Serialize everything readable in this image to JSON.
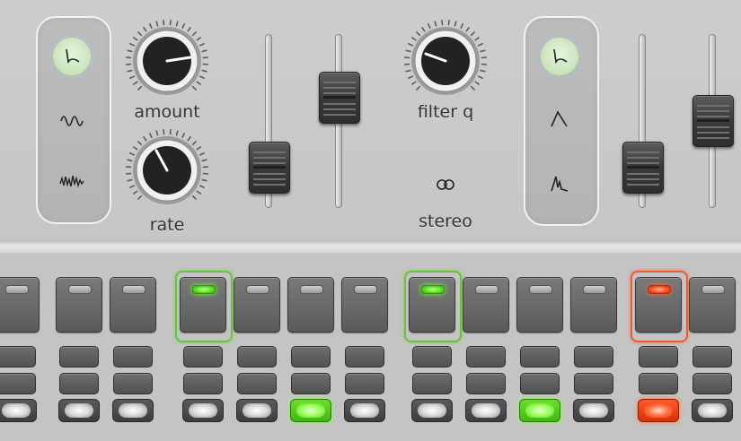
{
  "lfo": {
    "waveforms": [
      {
        "icon": "decay-envelope-icon",
        "active": true
      },
      {
        "icon": "sine-wave-icon",
        "active": false
      },
      {
        "icon": "noise-wave-icon",
        "active": false
      }
    ],
    "amount_label": "amount",
    "rate_label": "rate",
    "amount_value": 0.72,
    "rate_value": 0.35,
    "slider_1_value": 0.2,
    "slider_2_value": 0.72
  },
  "filter": {
    "q_label": "filter q",
    "q_value": 0.33,
    "stereo_label": "stereo",
    "stereo_icon": "stereo-rings-icon"
  },
  "envelope": {
    "shapes": [
      {
        "icon": "decay-envelope-icon",
        "active": true
      },
      {
        "icon": "attack-decay-icon",
        "active": false
      },
      {
        "icon": "spike-envelope-icon",
        "active": false
      }
    ],
    "slider_1_value": 0.2,
    "slider_2_value": 0.55
  },
  "colors": {
    "accent_green": "#4fe21b",
    "accent_red": "#ff4a1a"
  },
  "sequencer": {
    "steps": [
      {
        "pad_state": "off",
        "light": "white"
      },
      {
        "pad_state": "off",
        "light": "white"
      },
      {
        "pad_state": "off",
        "light": "white"
      },
      {
        "pad_state": "green",
        "light": "white"
      },
      {
        "pad_state": "off",
        "light": "white"
      },
      {
        "pad_state": "off",
        "light": "green"
      },
      {
        "pad_state": "off",
        "light": "white"
      },
      {
        "pad_state": "green",
        "light": "white"
      },
      {
        "pad_state": "off",
        "light": "white"
      },
      {
        "pad_state": "off",
        "light": "green"
      },
      {
        "pad_state": "off",
        "light": "white"
      },
      {
        "pad_state": "red",
        "light": "red"
      },
      {
        "pad_state": "off",
        "light": "white"
      }
    ]
  }
}
